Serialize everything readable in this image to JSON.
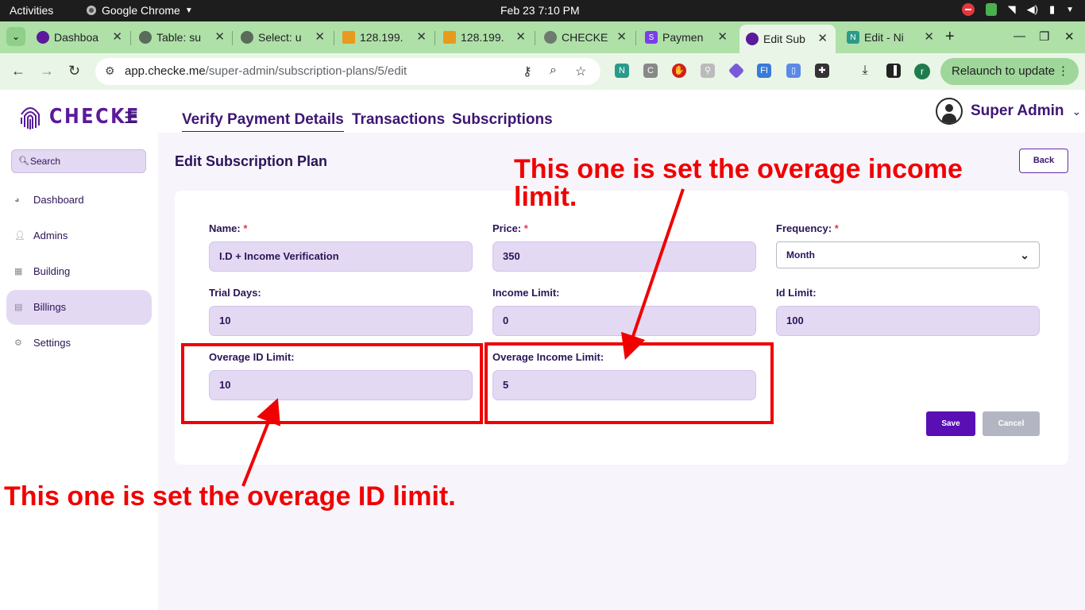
{
  "os_bar": {
    "activities": "Activities",
    "app_name": "Google Chrome",
    "clock": "Feb 23  7:10 PM"
  },
  "browser": {
    "tabs": [
      {
        "title": "Dashboa",
        "icon": "checke-fingerprint-icon"
      },
      {
        "title": "Table: su",
        "icon": "github-icon"
      },
      {
        "title": "Select: u",
        "icon": "github-icon"
      },
      {
        "title": "128.199.",
        "icon": "phpmyadmin-icon"
      },
      {
        "title": "128.199.",
        "icon": "phpmyadmin-icon"
      },
      {
        "title": "CHECKE",
        "icon": "globe-icon"
      },
      {
        "title": "Paymen",
        "icon": "stripe-icon"
      },
      {
        "title": "Edit Sub",
        "icon": "checke-fingerprint-icon",
        "active": true
      },
      {
        "title": "Edit - Ni",
        "icon": "notion-icon"
      }
    ],
    "url_host": "app.checke.me",
    "url_path": "/super-admin/subscription-plans/5/edit",
    "profile_initial": "r",
    "relaunch_label": "Relaunch to update"
  },
  "app": {
    "logo_text": "CHECKE",
    "search_placeholder": "Search",
    "nav": [
      {
        "label": "Dashboard",
        "icon": "pie-chart-icon"
      },
      {
        "label": "Admins",
        "icon": "user-icon"
      },
      {
        "label": "Building",
        "icon": "building-icon"
      },
      {
        "label": "Billings",
        "icon": "receipt-icon",
        "active": true
      },
      {
        "label": "Settings",
        "icon": "gears-icon"
      }
    ],
    "top_links": [
      "Verify Payment Details",
      "Transactions",
      "Subscriptions"
    ],
    "user_name": "Super Admin",
    "page_title": "Edit Subscription Plan",
    "back_label": "Back",
    "form": {
      "name": {
        "label": "Name:",
        "required": "*",
        "value": "I.D + Income Verification"
      },
      "price": {
        "label": "Price:",
        "required": "*",
        "value": "350"
      },
      "frequency": {
        "label": "Frequency:",
        "required": "*",
        "value": "Month"
      },
      "trial_days": {
        "label": "Trial Days:",
        "value": "10"
      },
      "income_limit": {
        "label": "Income Limit:",
        "value": "0"
      },
      "id_limit": {
        "label": "Id Limit:",
        "value": "100"
      },
      "overage_id_limit": {
        "label": "Overage ID Limit:",
        "value": "10"
      },
      "overage_income_limit": {
        "label": "Overage Income Limit:",
        "value": "5"
      }
    },
    "save_label": "Save",
    "cancel_label": "Cancel"
  },
  "annotations": {
    "income_note": "This one is set the overage income limit.",
    "id_note": "This one is set the overage ID limit."
  },
  "colors": {
    "annotation": "#f00000",
    "brand_purple": "#5a0fb5",
    "input_bg": "#e4d9f3",
    "chrome_green": "#aee0a8"
  }
}
